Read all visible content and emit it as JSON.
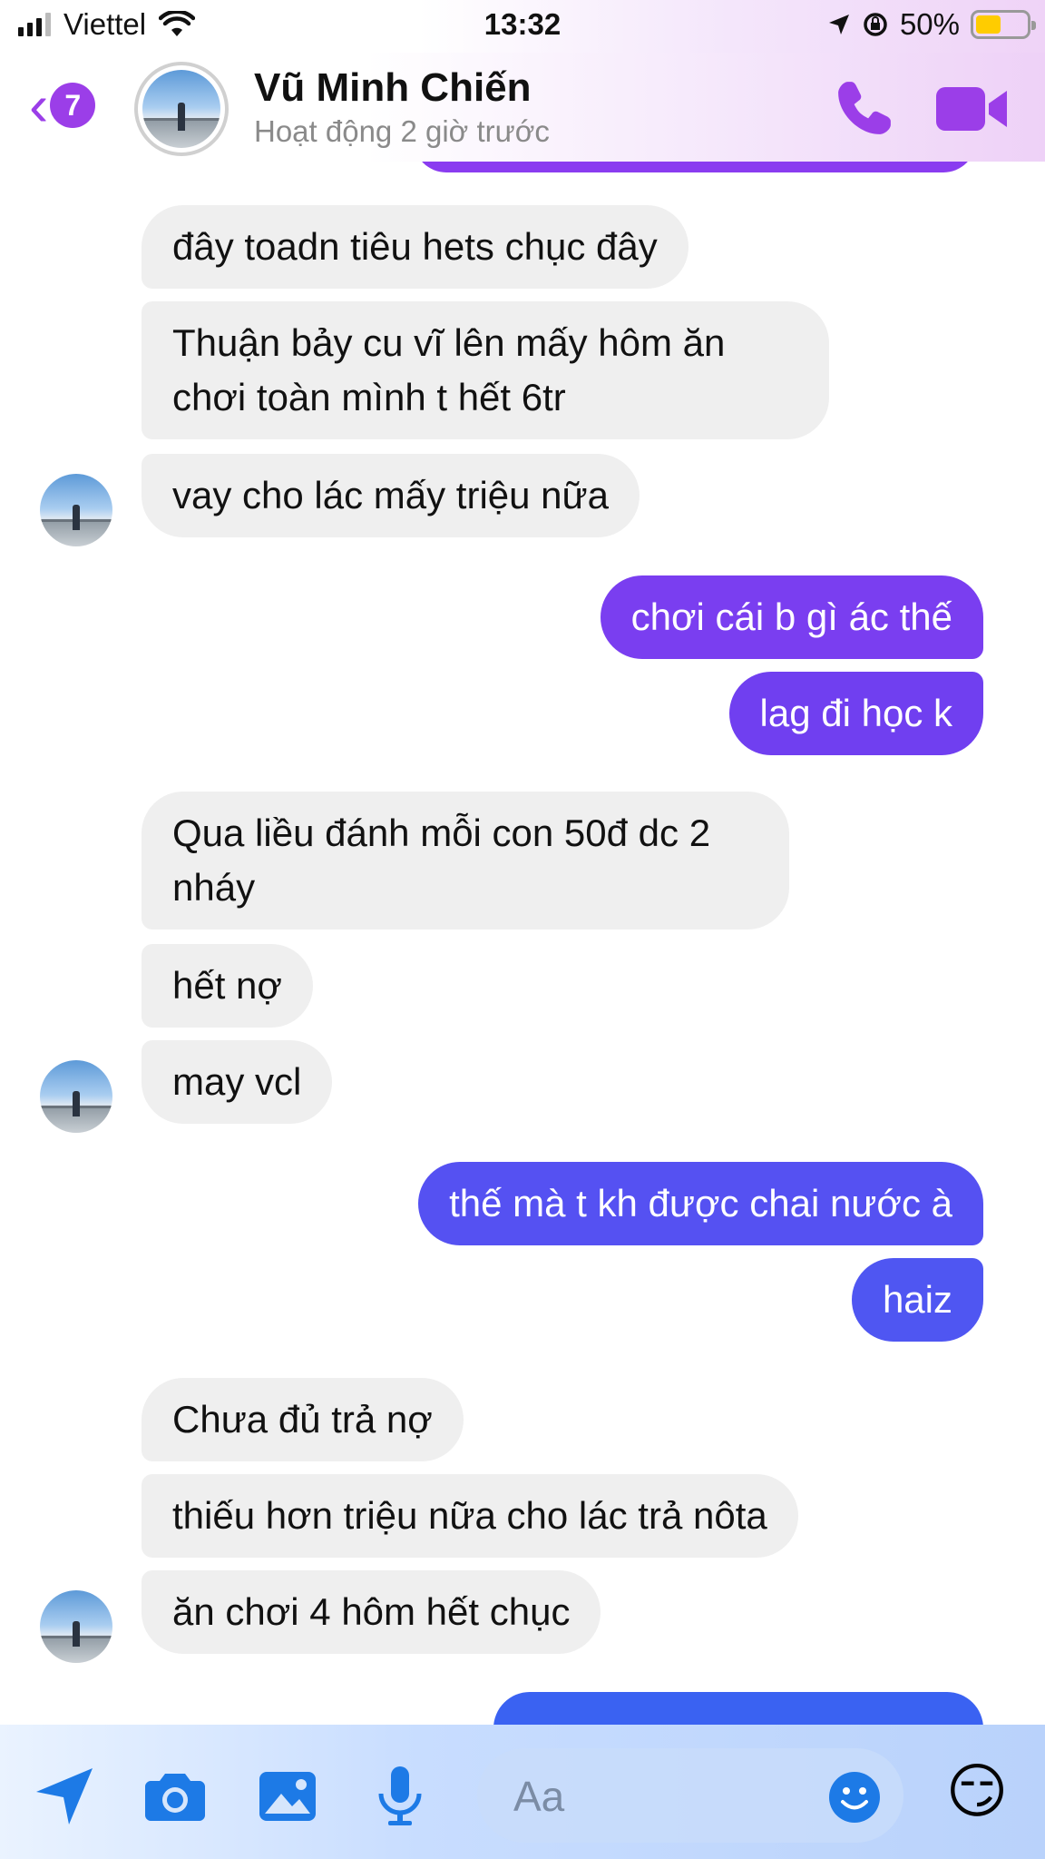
{
  "status_bar": {
    "carrier": "Viettel",
    "time": "13:32",
    "battery": "50%",
    "battery_level": 0.5
  },
  "header": {
    "back_badge": "7",
    "contact_name": "Vũ Minh Chiến",
    "status": "Hoạt động 2 giờ trước",
    "icons": [
      "chevron-left-icon",
      "phone-icon",
      "video-icon"
    ]
  },
  "messages": [
    {
      "from": "contact",
      "text": "đây toadn tiêu hets chục đây"
    },
    {
      "from": "contact",
      "text": "Thuận bảy cu vĩ lên mấy hôm ăn chơi toàn mình t hết 6tr"
    },
    {
      "from": "contact",
      "text": "vay cho lác mấy triệu nữa"
    },
    {
      "from": "me",
      "text": "chơi cái b gì ác thế"
    },
    {
      "from": "me",
      "text": "lag đi học k"
    },
    {
      "from": "contact",
      "text": "Qua liều đánh mỗi con 50đ dc 2 nháy"
    },
    {
      "from": "contact",
      "text": "hết nợ"
    },
    {
      "from": "contact",
      "text": "may vcl"
    },
    {
      "from": "me",
      "text": "thế mà t kh được chai nước à"
    },
    {
      "from": "me",
      "text": "haiz"
    },
    {
      "from": "contact",
      "text": "Chưa đủ trả nợ"
    },
    {
      "from": "contact",
      "text": "thiếu hơn triệu nữa cho lác trả nôta"
    },
    {
      "from": "contact",
      "text": "ăn chơi 4 hôm hết chục"
    }
  ],
  "composer": {
    "placeholder": "Aa",
    "emoji": "😏",
    "icons": [
      "send-arrow-icon",
      "camera-icon",
      "image-icon",
      "microphone-icon",
      "smile-icon"
    ]
  },
  "colors": {
    "accent_purple": "#9b3ee8",
    "bubble_out_purple": "#7a3df0",
    "bubble_out_blue": "#4e55f2",
    "bubble_in": "#efefef",
    "composer_icon_blue": "#1d7ae6"
  }
}
